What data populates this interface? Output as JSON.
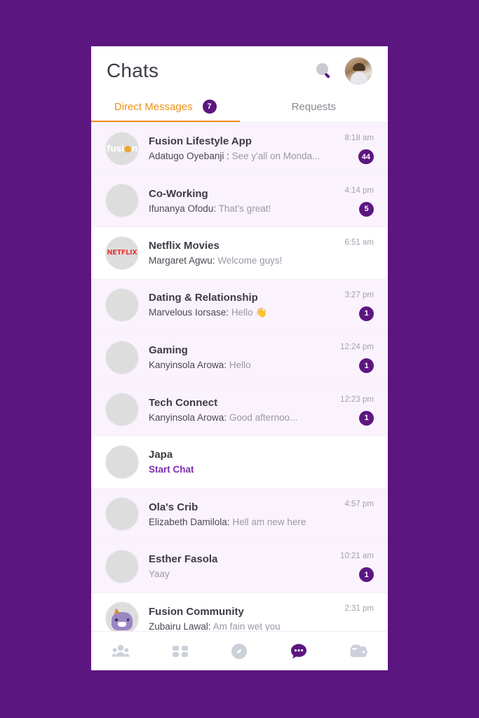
{
  "app": {
    "frame_bg": "#5c1680",
    "accent_purple": "#5c1680",
    "accent_orange": "#ee9016",
    "unread_row_bg": "#faf3fe"
  },
  "header": {
    "title": "Chats",
    "search_icon": "search-icon",
    "avatar": "user-avatar"
  },
  "tabs": [
    {
      "label": "Direct Messages",
      "badge": "7",
      "active": true
    },
    {
      "label": "Requests",
      "badge": "",
      "active": false
    }
  ],
  "chats": [
    {
      "name": "Fusion Lifestyle App",
      "sender": "Adatugo Oyebanji :",
      "message": "See y'all on Monda...",
      "time": "8:18 am",
      "badge": "44",
      "unread": true,
      "avatar": "fusion-logo"
    },
    {
      "name": "Co-Working",
      "sender": "Ifunanya Ofodu:",
      "message": "That's great!",
      "time": "4:14 pm",
      "badge": "5",
      "unread": true,
      "avatar": "group-photo-couple"
    },
    {
      "name": "Netflix Movies",
      "sender": "Margaret Agwu:",
      "message": "Welcome guys!",
      "time": "6:51 am",
      "badge": "",
      "unread": false,
      "avatar": "netflix-logo"
    },
    {
      "name": "Dating & Relationship",
      "sender": "Marvelous Iorsase:",
      "message": "Hello 👋",
      "time": "3:27 pm",
      "badge": "1",
      "unread": true,
      "avatar": "group-photo-friends"
    },
    {
      "name": "Gaming",
      "sender": "Kanyinsola Arowa:",
      "message": "Hello",
      "time": "12:24 pm",
      "badge": "1",
      "unread": true,
      "avatar": "group-photo-gaming"
    },
    {
      "name": "Tech Connect",
      "sender": "Kanyinsola Arowa:",
      "message": "Good afternoo...",
      "time": "12:23 pm",
      "badge": "1",
      "unread": true,
      "avatar": "group-photo-office"
    },
    {
      "name": "Japa",
      "sender": "",
      "message": "Start Chat",
      "time": "",
      "badge": "",
      "unread": false,
      "start_chat": true,
      "avatar": "group-photo-hands"
    },
    {
      "name": "Ola's Crib",
      "sender": "Elizabeth Damilola:",
      "message": "Hell am new here",
      "time": "4:57 pm",
      "badge": "",
      "unread": true,
      "avatar": "person-photo-ola"
    },
    {
      "name": "Esther Fasola",
      "sender": "",
      "message": "Yaay",
      "time": "10:21 am",
      "badge": "1",
      "unread": true,
      "avatar": "person-photo-esther"
    },
    {
      "name": "Fusion Community",
      "sender": "Zubairu Lawal:",
      "message": "Am fain wet you",
      "time": "2:31 pm",
      "badge": "",
      "unread": false,
      "avatar": "mascot-logo"
    }
  ],
  "bottom_nav": [
    {
      "icon": "people-group-icon",
      "active": false
    },
    {
      "icon": "grid-dashboard-icon",
      "active": false
    },
    {
      "icon": "compass-explore-icon",
      "active": false
    },
    {
      "icon": "chat-bubble-icon",
      "active": true
    },
    {
      "icon": "wallet-icon",
      "active": false
    }
  ]
}
